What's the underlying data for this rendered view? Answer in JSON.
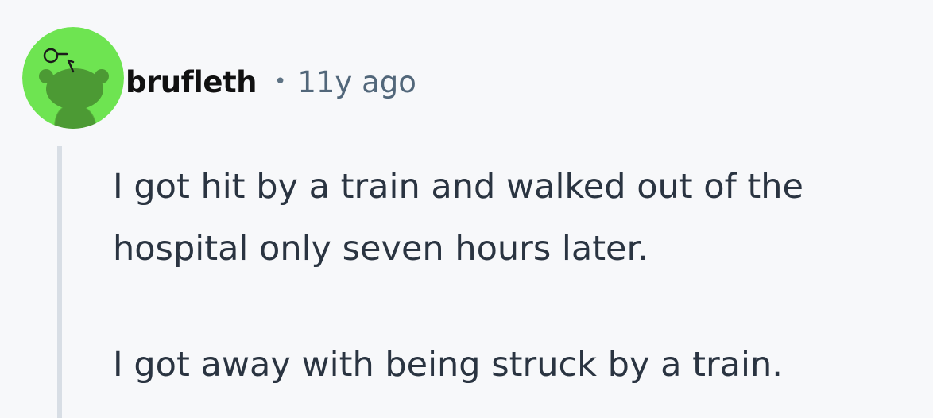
{
  "comment": {
    "author": "brufleth",
    "separator": "•",
    "timestamp": "11y ago",
    "paragraphs": [
      "I got hit by a train and walked out of the hospital only seven hours later.",
      "I got away with being struck by a train."
    ]
  },
  "colors": {
    "background": "#f7f8fa",
    "avatar_bg": "#6ee451",
    "avatar_figure": "#4c9a34",
    "thread_line": "#d8dee5",
    "author_text": "#111111",
    "timestamp_text": "#52677a",
    "body_text": "#2a3441"
  },
  "icons": {
    "avatar": "reddit-snoo-avatar-icon"
  }
}
